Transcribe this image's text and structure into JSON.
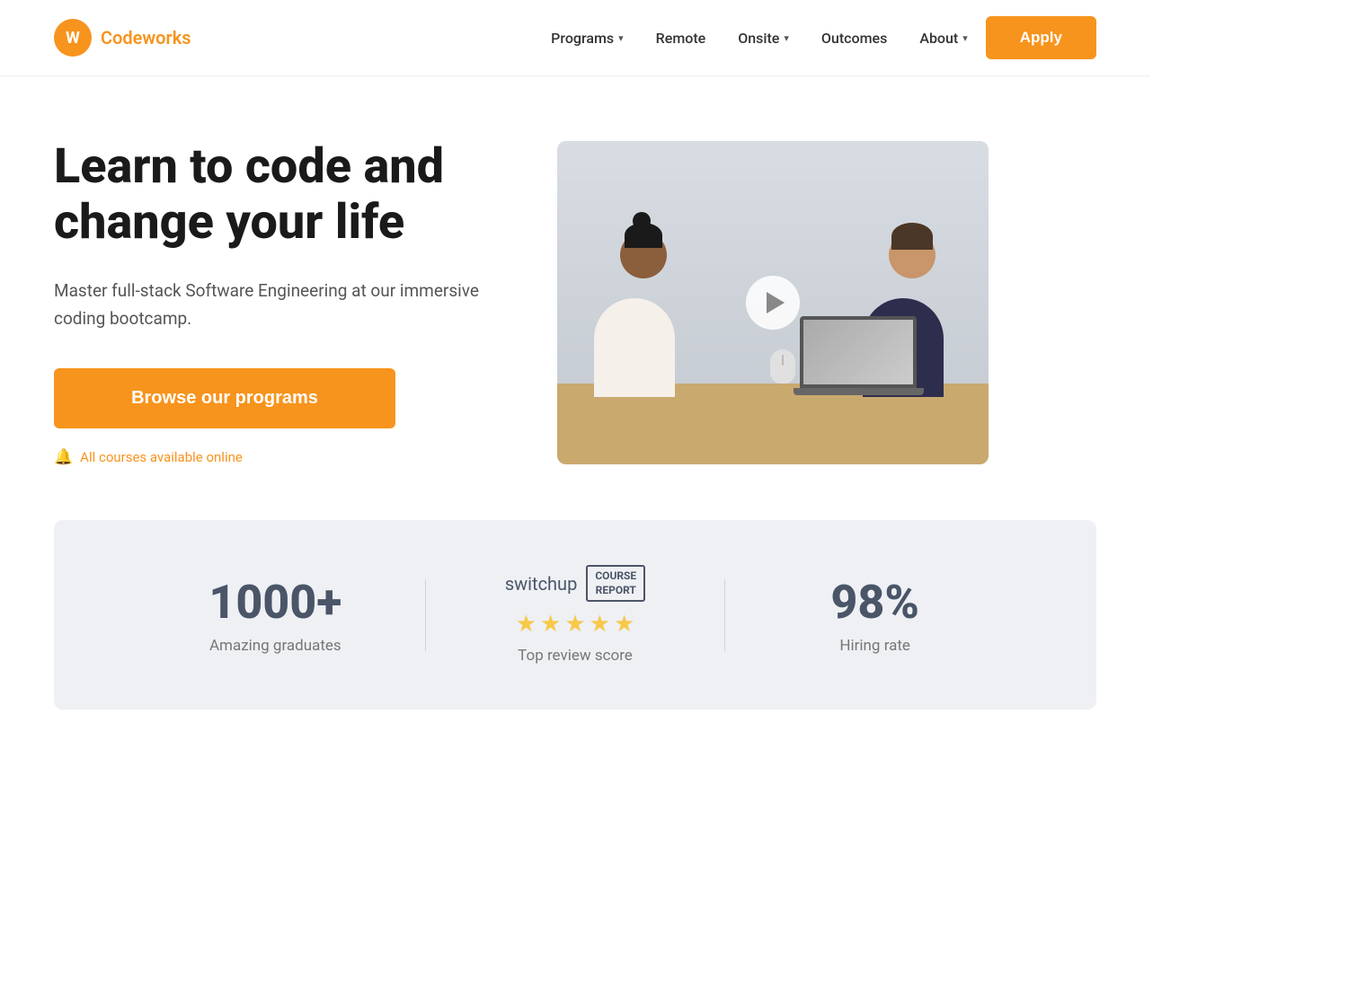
{
  "logo": {
    "letter": "W",
    "name": "Codeworks"
  },
  "nav": {
    "links": [
      {
        "label": "Programs",
        "has_arrow": true
      },
      {
        "label": "Remote",
        "has_arrow": false
      },
      {
        "label": "Onsite",
        "has_arrow": true
      },
      {
        "label": "Outcomes",
        "has_arrow": false
      },
      {
        "label": "About",
        "has_arrow": true
      }
    ],
    "apply_label": "Apply"
  },
  "hero": {
    "heading_line1": "Learn to code and",
    "heading_line2": "change your life",
    "subtext": "Master full-stack Software Engineering at our immersive coding bootcamp.",
    "browse_label": "Browse our programs",
    "online_notice": "All courses available online"
  },
  "video": {
    "play_title": "Play video"
  },
  "stats": [
    {
      "id": "graduates",
      "number": "1000+",
      "label": "Amazing graduates"
    },
    {
      "id": "reviews",
      "switchup": "switchup",
      "course_report_line1": "COURSE",
      "course_report_line2": "REPORT",
      "stars": 5,
      "label": "Top review score"
    },
    {
      "id": "hiring",
      "number": "98%",
      "label": "Hiring rate"
    }
  ]
}
